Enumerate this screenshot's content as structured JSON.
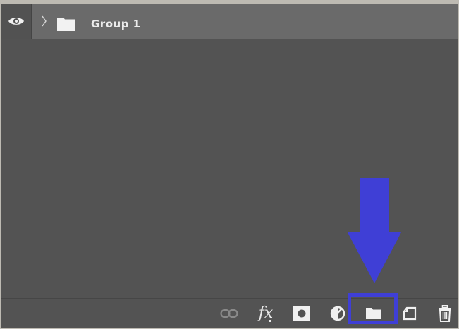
{
  "layer": {
    "name": "Group 1",
    "visibility_icon": "eye-icon",
    "expand_icon": "chevron-right-icon",
    "type_icon": "folder-icon"
  },
  "toolbar": {
    "buttons": [
      {
        "name": "link-layers-button",
        "icon": "link-icon"
      },
      {
        "name": "add-layer-style-button",
        "icon": "fx-icon",
        "label": "fx"
      },
      {
        "name": "add-layer-mask-button",
        "icon": "mask-icon"
      },
      {
        "name": "new-fill-adjustment-layer-button",
        "icon": "half-circle-icon"
      },
      {
        "name": "create-new-group-button",
        "icon": "folder-icon"
      },
      {
        "name": "create-new-layer-button",
        "icon": "new-layer-icon"
      },
      {
        "name": "delete-layer-button",
        "icon": "trash-icon"
      }
    ]
  },
  "annotation": {
    "arrow_icon": "down-arrow-icon",
    "highlight_color": "#3f3fd6",
    "highlighted_button": "create-new-group-button"
  },
  "colors": {
    "panel_bg": "#535353",
    "row_bg": "#6a6a6a",
    "icon": "#eaeaea",
    "annotation": "#3f3fd6"
  }
}
